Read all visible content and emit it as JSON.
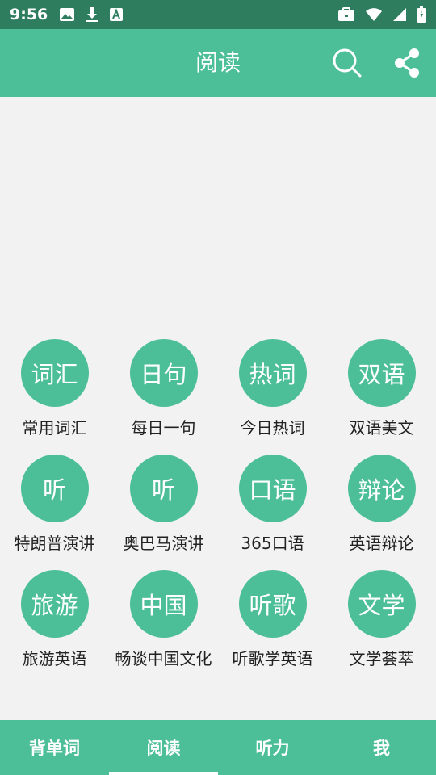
{
  "status_bar": {
    "time": "9:56",
    "icons": [
      "image-icon",
      "download-icon",
      "font-icon",
      "briefcase-icon",
      "wifi-icon",
      "signal-icon",
      "battery-icon"
    ]
  },
  "app_bar": {
    "title": "阅读",
    "background": "#4cbf98",
    "actions": [
      "search-icon",
      "share-icon"
    ]
  },
  "grid": [
    {
      "circle": "词汇",
      "label": "常用词汇"
    },
    {
      "circle": "日句",
      "label": "每日一句"
    },
    {
      "circle": "热词",
      "label": "今日热词"
    },
    {
      "circle": "双语",
      "label": "双语美文"
    },
    {
      "circle": "听",
      "label": "特朗普演讲"
    },
    {
      "circle": "听",
      "label": "奥巴马演讲"
    },
    {
      "circle": "口语",
      "label": "365口语"
    },
    {
      "circle": "辩论",
      "label": "英语辩论"
    },
    {
      "circle": "旅游",
      "label": "旅游英语"
    },
    {
      "circle": "中国",
      "label": "畅谈中国文化"
    },
    {
      "circle": "听歌",
      "label": "听歌学英语"
    },
    {
      "circle": "文学",
      "label": "文学荟萃"
    }
  ],
  "bottom_nav": {
    "tabs": [
      "背单词",
      "阅读",
      "听力",
      "我"
    ],
    "selected": "阅读"
  },
  "colors": {
    "accent": "#4cbf98",
    "status_bar": "#2f7d5f",
    "background": "#f2f2f2"
  }
}
